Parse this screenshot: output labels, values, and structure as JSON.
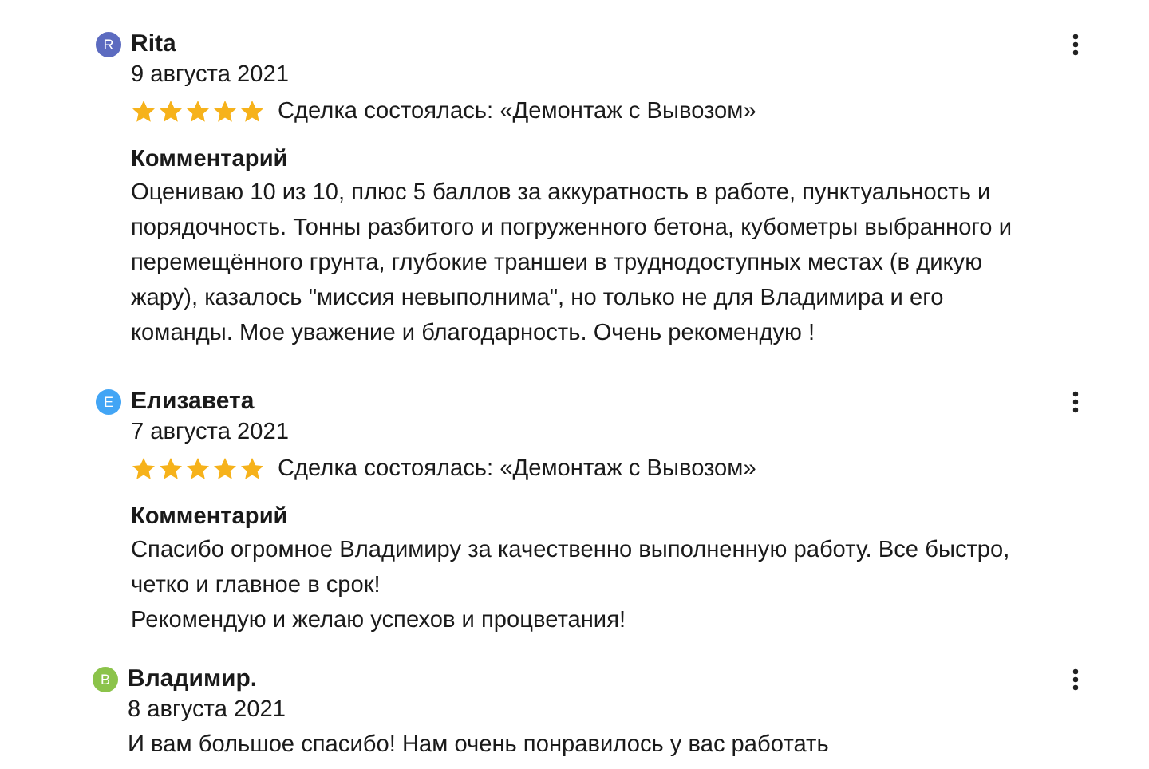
{
  "reviews": [
    {
      "author": "Rita",
      "initial": "R",
      "color": "#5c6bc0",
      "date": "9 августа 2021",
      "stars": 5,
      "deal": "Сделка состоялась: «Демонтаж с Вывозом»",
      "comment_heading": "Комментарий",
      "comment_lines": [
        "Оцениваю 10 из 10, плюс 5 баллов за аккуратность в работе, пунктуальность и",
        "порядочность. Тонны разбитого и погруженного бетона, кубометры выбранного и",
        "перемещённого грунта, глубокие траншеи в труднодоступных местах (в дикую",
        "жару), казалось \"миссия невыполнима\", но только не для Владимира и его",
        "команды. Мое уважение и благодарность. Очень рекомендую !"
      ]
    },
    {
      "author": "Елизавета",
      "initial": "Е",
      "color": "#42a5f5",
      "date": "7 августа 2021",
      "stars": 5,
      "deal": "Сделка состоялась: «Демонтаж с Вывозом»",
      "comment_heading": "Комментарий",
      "comment_lines": [
        "Спасибо огромное Владимиру за качественно выполненную работу. Все быстро,",
        "четко и главное в срок!",
        "Рекомендую и желаю успехов и процветания!"
      ],
      "reply": {
        "author": "Владимир.",
        "initial": "В",
        "color": "#8bc34a",
        "date": "8 августа 2021",
        "text": "И вам большое спасибо! Нам очень понравилось у вас работать"
      }
    }
  ]
}
